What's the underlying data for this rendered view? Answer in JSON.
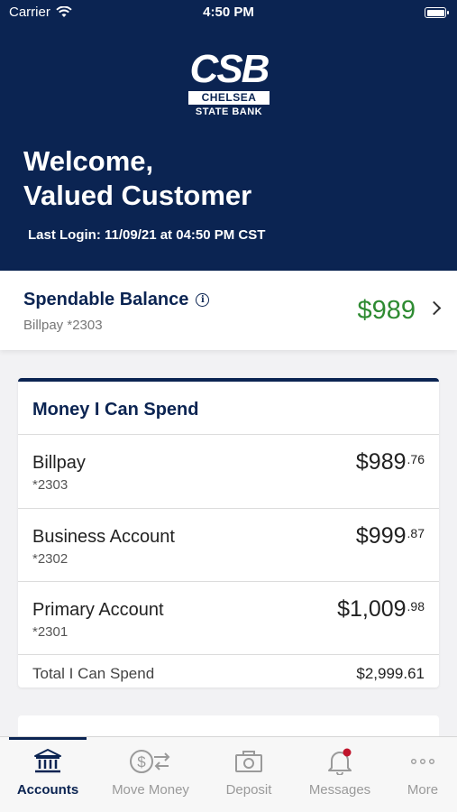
{
  "status": {
    "carrier": "Carrier",
    "time": "4:50 PM"
  },
  "logo": {
    "mark": "CSB",
    "bar": "CHELSEA",
    "sub": "STATE BANK"
  },
  "welcome": {
    "line1": "Welcome,",
    "line2": "Valued Customer",
    "last_login": "Last Login: 11/09/21 at 04:50 PM CST"
  },
  "spendable": {
    "title": "Spendable Balance",
    "info": "i",
    "account": "Billpay *2303",
    "amount": "$989"
  },
  "money_card": {
    "title": "Money I Can Spend",
    "accounts": [
      {
        "name": "Billpay",
        "number": "*2303",
        "dollars": "$989",
        "cents": ".76"
      },
      {
        "name": "Business Account",
        "number": "*2302",
        "dollars": "$999",
        "cents": ".87"
      },
      {
        "name": "Primary Account",
        "number": "*2301",
        "dollars": "$1,009",
        "cents": ".98"
      }
    ],
    "total_label": "Total I Can Spend",
    "total_value": "$2,999.61"
  },
  "tabs": [
    {
      "label": "Accounts",
      "icon": "bank-icon",
      "active": true
    },
    {
      "label": "Move Money",
      "icon": "move-money-icon",
      "active": false
    },
    {
      "label": "Deposit",
      "icon": "camera-icon",
      "active": false
    },
    {
      "label": "Messages",
      "icon": "bell-icon",
      "active": false,
      "badge": true
    },
    {
      "label": "More",
      "icon": "more-icon",
      "active": false
    }
  ],
  "colors": {
    "navy": "#0b2452",
    "green": "#2e8b32",
    "badge": "#c0142b"
  }
}
